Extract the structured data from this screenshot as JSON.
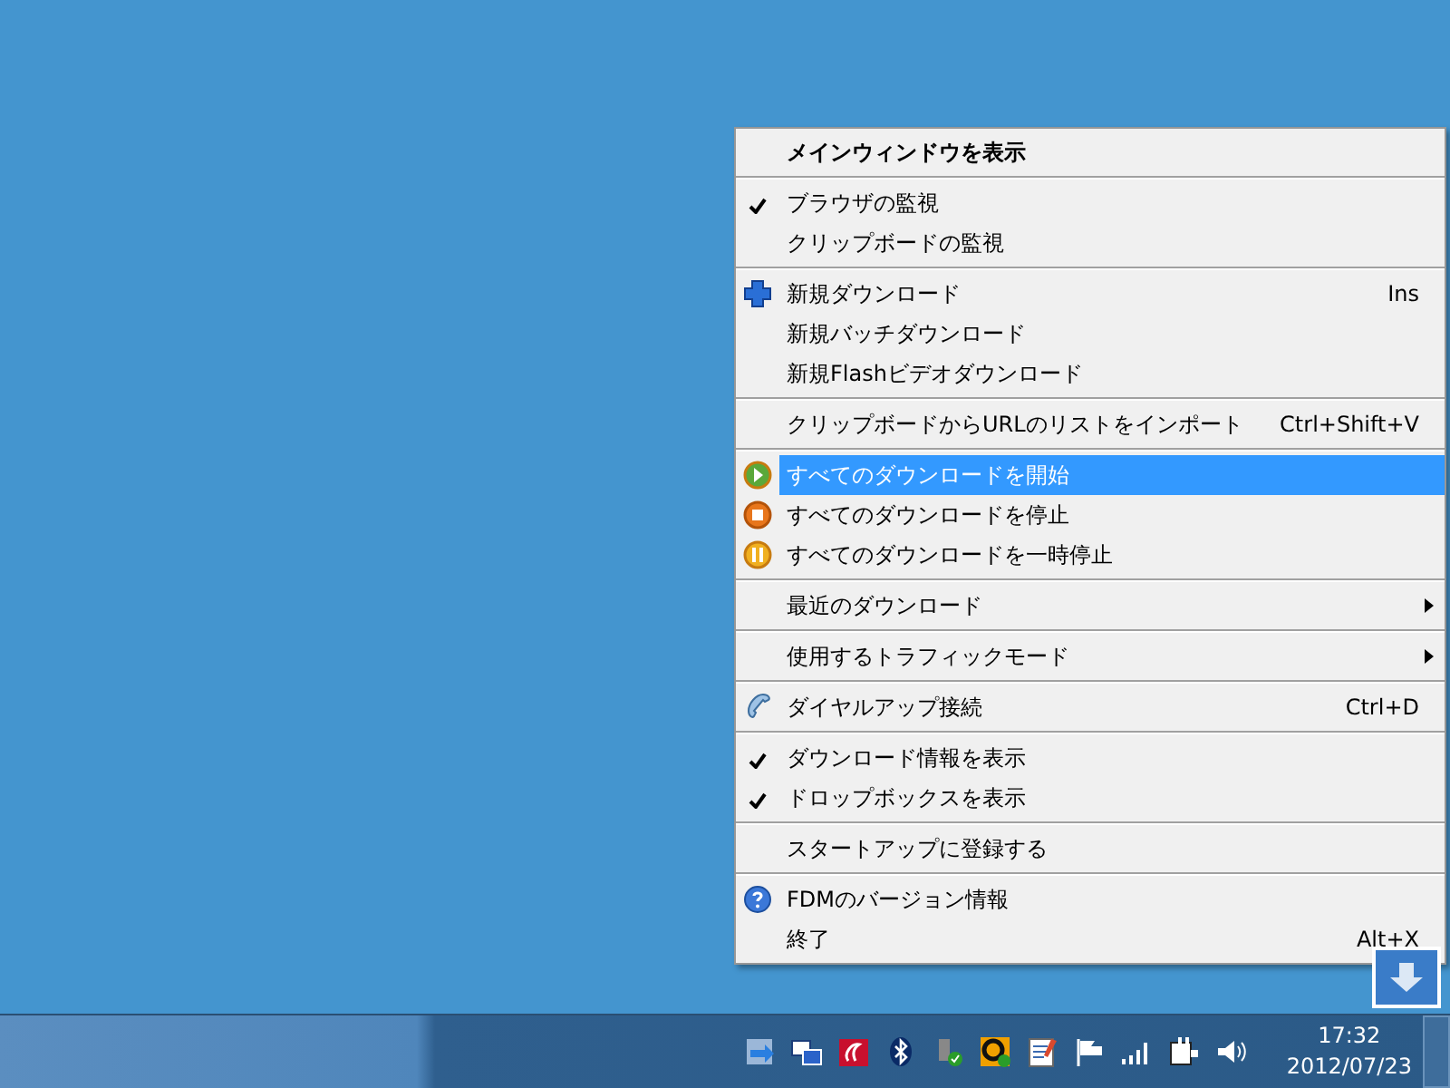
{
  "menu": {
    "sections": [
      [
        {
          "label": "メインウィンドウを表示",
          "kind": "default",
          "checked": false,
          "selected": false
        }
      ],
      [
        {
          "label": "ブラウザの監視",
          "kind": "plain",
          "checked": true,
          "selected": false
        },
        {
          "label": "クリップボードの監視",
          "kind": "plain",
          "checked": false,
          "selected": false
        }
      ],
      [
        {
          "label": "新規ダウンロード",
          "kind": "add",
          "shortcut": "Ins",
          "checked": false,
          "selected": false
        },
        {
          "label": "新規バッチダウンロード",
          "kind": "plain",
          "checked": false,
          "selected": false
        },
        {
          "label": "新規Flashビデオダウンロード",
          "kind": "plain",
          "checked": false,
          "selected": false
        }
      ],
      [
        {
          "label": "クリップボードからURLのリストをインポート",
          "kind": "plain",
          "shortcut": "Ctrl+Shift+V",
          "checked": false,
          "selected": false
        }
      ],
      [
        {
          "label": "すべてのダウンロードを開始",
          "kind": "start",
          "checked": false,
          "selected": true
        },
        {
          "label": "すべてのダウンロードを停止",
          "kind": "stop",
          "checked": false,
          "selected": false
        },
        {
          "label": "すべてのダウンロードを一時停止",
          "kind": "pause",
          "checked": false,
          "selected": false
        }
      ],
      [
        {
          "label": "最近のダウンロード",
          "kind": "submenu",
          "checked": false,
          "selected": false
        }
      ],
      [
        {
          "label": "使用するトラフィックモード",
          "kind": "submenu",
          "checked": false,
          "selected": false
        }
      ],
      [
        {
          "label": "ダイヤルアップ接続",
          "kind": "dialup",
          "shortcut": "Ctrl+D",
          "checked": false,
          "selected": false
        }
      ],
      [
        {
          "label": "ダウンロード情報を表示",
          "kind": "plain",
          "checked": true,
          "selected": false
        },
        {
          "label": "ドロップボックスを表示",
          "kind": "plain",
          "checked": true,
          "selected": false
        }
      ],
      [
        {
          "label": "スタートアップに登録する",
          "kind": "plain",
          "checked": false,
          "selected": false
        }
      ],
      [
        {
          "label": "FDMのバージョン情報",
          "kind": "about",
          "checked": false,
          "selected": false
        },
        {
          "label": "終了",
          "kind": "plain",
          "shortcut": "Alt+X",
          "checked": false,
          "selected": false
        }
      ]
    ]
  },
  "taskbar": {
    "time": "17:32",
    "date": "2012/07/23"
  }
}
